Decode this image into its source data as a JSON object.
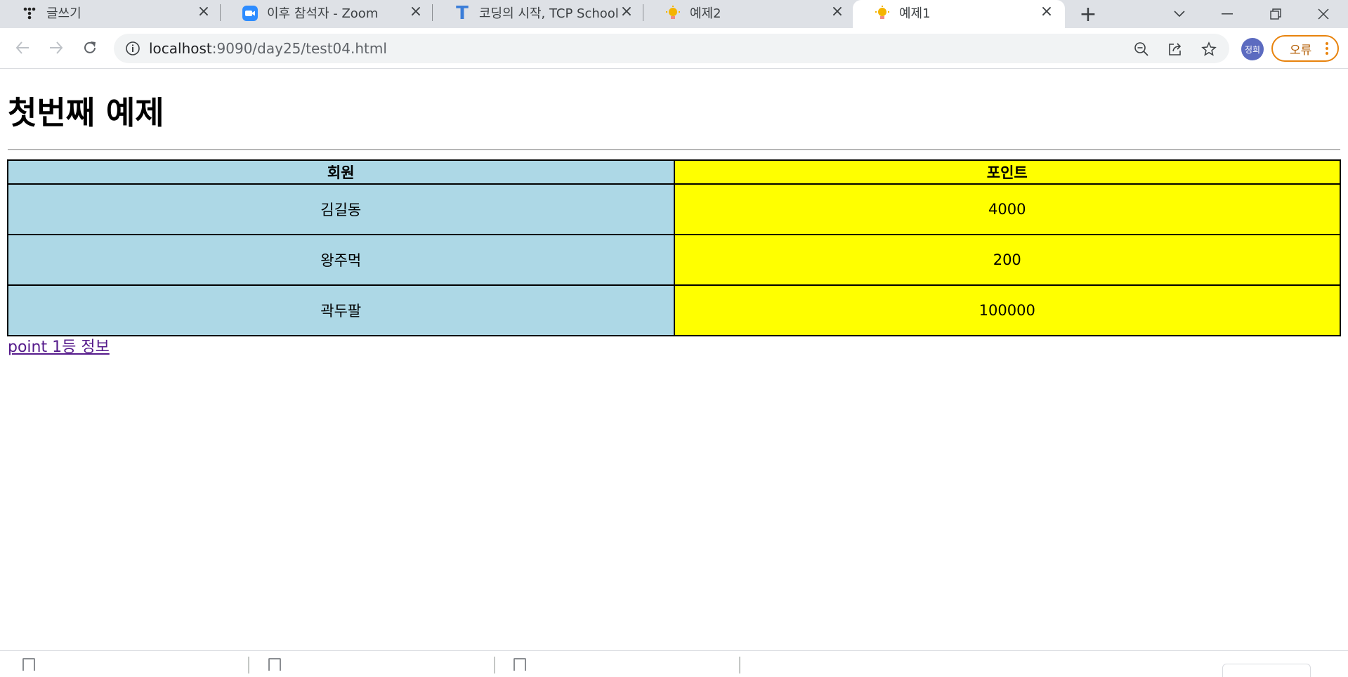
{
  "tabs": [
    {
      "title": "글쓰기",
      "icon": "tistory-icon"
    },
    {
      "title": "이후 참석자 - Zoom",
      "icon": "zoom-icon"
    },
    {
      "title": "코딩의 시작, TCP School",
      "icon": "tcp-school-icon"
    },
    {
      "title": "예제2",
      "icon": "bulb-icon"
    },
    {
      "title": "예제1",
      "icon": "bulb-icon",
      "active": true
    }
  ],
  "address_bar": {
    "host": "localhost",
    "path": ":9090/day25/test04.html"
  },
  "profile": {
    "label": "정희"
  },
  "error_chip": {
    "label": "오류"
  },
  "page": {
    "title": "첫번째 예제",
    "table": {
      "headers": [
        "회원",
        "포인트"
      ],
      "rows": [
        [
          "김길동",
          "4000"
        ],
        [
          "왕주먹",
          "200"
        ],
        [
          "곽두팔",
          "100000"
        ]
      ]
    },
    "link": "point 1등 정보"
  },
  "colors": {
    "member_column": "#add8e6",
    "point_column": "#ffff00",
    "link": "#551a8b",
    "error_chip_border": "#e8830d"
  }
}
